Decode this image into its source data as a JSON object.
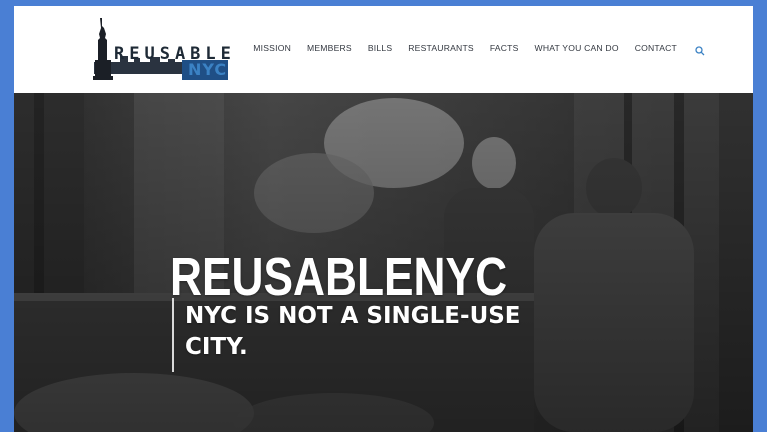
{
  "logo": {
    "word": "REUSABLE",
    "sub": "NYC",
    "icon": "statue-of-liberty-icon"
  },
  "nav": {
    "items": [
      {
        "label": "MISSION"
      },
      {
        "label": "MEMBERS"
      },
      {
        "label": "BILLS"
      },
      {
        "label": "RESTAURANTS"
      },
      {
        "label": "FACTS"
      },
      {
        "label": "WHAT YOU CAN DO"
      },
      {
        "label": "CONTACT"
      }
    ],
    "search_icon": "search-icon"
  },
  "hero": {
    "title": "REUSABLENYC",
    "tagline_line1": "NYC IS NOT A SINGLE-USE",
    "tagline_line2": "CITY."
  },
  "colors": {
    "frame_border": "#4a7fd4",
    "accent_blue": "#3b82c4",
    "nav_text": "#333840",
    "hero_text": "#ffffff"
  }
}
